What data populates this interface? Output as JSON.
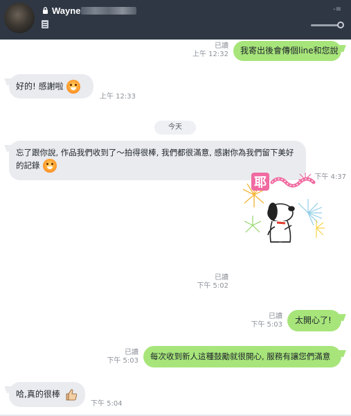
{
  "header": {
    "title": "Wayne",
    "menu_glyph": "-≡",
    "icons": {
      "lock": "lock-icon",
      "notes": "notes-icon",
      "menu": "menu-icon",
      "slider": "zoom-slider"
    }
  },
  "messages": [
    {
      "text": "我寄出後會傳個line和您說",
      "status": "已讀",
      "time": "上午 12:32"
    },
    {
      "text": "好的!  感謝啦",
      "time": "上午 12:33"
    },
    {
      "day": "今天"
    },
    {
      "text_line1": "忘了跟你說, 作品我們收到了～拍得很棒, 我們都很滿意, 感謝你為我們留下美好",
      "text_line2": "的記錄",
      "time": "下午 4:37"
    },
    {
      "sticker": "snoopy-fireworks-sticker",
      "status": "已讀",
      "time": "下午 5:02"
    },
    {
      "text": "太開心了!",
      "status": "已讀",
      "time": "下午 5:03"
    },
    {
      "text": "每次收到新人這種鼓勵就很開心, 服務有讓您們滿意",
      "status": "已讀",
      "time": "下午 5:03"
    },
    {
      "text": "哈,真的很棒",
      "time": "下午 5:04"
    }
  ],
  "colors": {
    "header": "#2f3744",
    "outgoing": "#a7e57b",
    "incoming": "#e9ebef",
    "meta": "#8b9098"
  }
}
